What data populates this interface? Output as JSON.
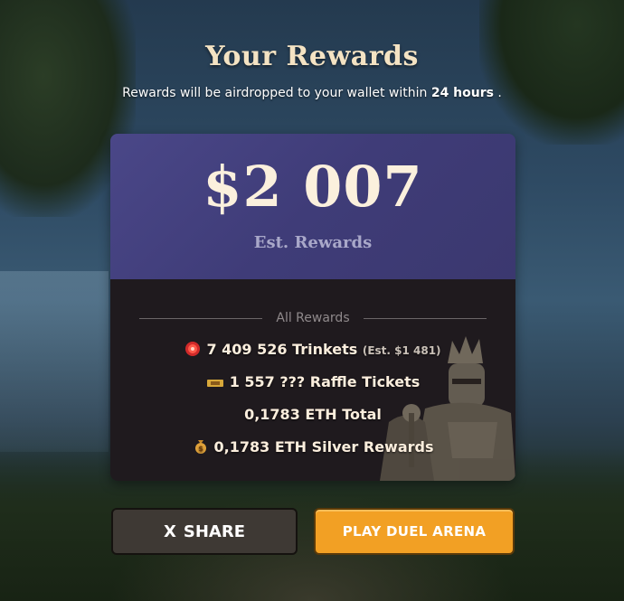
{
  "header": {
    "title": "Your Rewards",
    "subtitle_prefix": "Rewards will be airdropped to your wallet within ",
    "subtitle_bold": "24 hours",
    "subtitle_suffix": " ."
  },
  "summary": {
    "amount": "$2 007",
    "label": "Est. Rewards"
  },
  "rewards": {
    "heading": "All Rewards",
    "items": [
      {
        "icon": "trinket-gem-icon",
        "text": "7 409 526 Trinkets",
        "note": "(Est. $1 481)"
      },
      {
        "icon": "raffle-ticket-icon",
        "text": "1 557 ??? Raffle Tickets"
      },
      {
        "text": "0,1783 ETH Total"
      },
      {
        "icon": "money-bag-icon",
        "text": "0,1783 ETH Silver Rewards"
      }
    ]
  },
  "actions": {
    "share_icon": "X",
    "share_label": "SHARE",
    "play_label": "PLAY DUEL ARENA"
  },
  "colors": {
    "card_top": "#3f3c78",
    "card_bottom": "#1f1a1e",
    "play_button": "#f2a024",
    "share_button": "#3e3934"
  }
}
